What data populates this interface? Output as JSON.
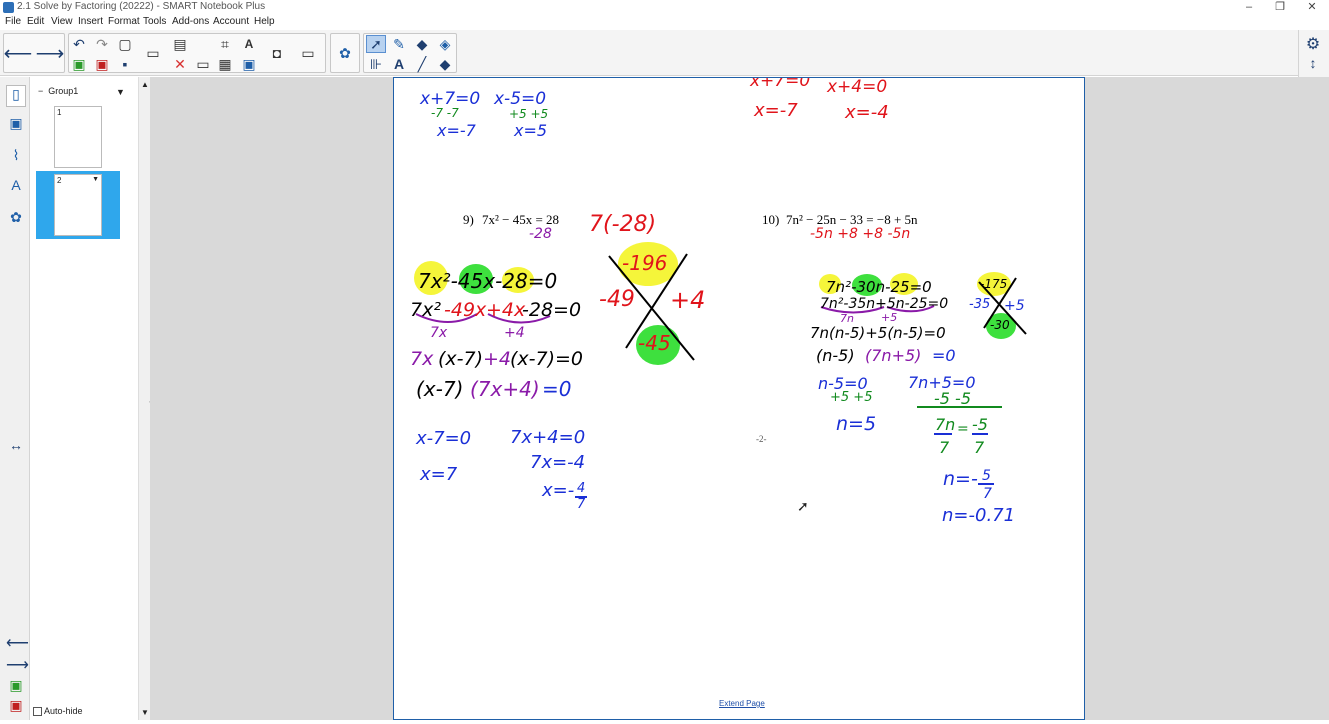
{
  "window": {
    "title": "2.1 Solve by Factoring (20222) - SMART Notebook Plus",
    "controls": [
      "–",
      "❐",
      "✕"
    ]
  },
  "menu": [
    "File",
    "Edit",
    "View",
    "Insert",
    "Format",
    "Tools",
    "Add-ons",
    "Account",
    "Help"
  ],
  "sorter": {
    "group_label": "Group1",
    "pages": [
      "1",
      "2"
    ]
  },
  "page_content": {
    "problem9_label": "9)",
    "problem9_eq": "7x² − 45x = 28",
    "problem10_label": "10)",
    "problem10_eq": "7n² − 25n − 33 = −8 + 5n",
    "page_number": "-2-",
    "extend_page": "Extend Page"
  },
  "handwriting": {
    "top_left_1": "x+7=0",
    "top_left_2": "-7  -7",
    "top_left_3": "x=-7",
    "top_mid_1": "x-5=0",
    "top_mid_2": "+5  +5",
    "top_mid_3": "x=5",
    "top_right_1": "x+7=0",
    "top_right_2": "x=-7",
    "top_right_3": "x+4=0",
    "top_right_4": "x=-4",
    "p9_sub": "-28",
    "p9_factor": "7(-28)",
    "p9_line1": "7x²-45x-28=0",
    "p9_line2a": "7x²",
    "p9_line2b": "-49x",
    "p9_line2c": "+4x",
    "p9_line2d": "-28=0",
    "p9_g1": "7x",
    "p9_g2": "+4",
    "p9_line3a": "7x",
    "p9_line3b": "(x-7)",
    "p9_line3c": "+4",
    "p9_line3d": "(x-7)=0",
    "p9_line4a": "(x-7)",
    "p9_line4b": "(7x+4)",
    "p9_line4c": "=0",
    "p9_x_top": "-196",
    "p9_x_left": "-49",
    "p9_x_right": "+4",
    "p9_x_bottom": "-45",
    "p9_sol1": "x-7=0",
    "p9_sol2": "x=7",
    "p9_sol3": "7x+4=0",
    "p9_sol4": "7x=-4",
    "p9_sol5": "x=-",
    "p9_frac_num": "4",
    "p9_frac_den": "7",
    "p10_sub": "-5n +8   +8 -5n",
    "p10_line1": "7n²-30n-25=0",
    "p10_line2": "7n²-35n+5n-25=0",
    "p10_g1": "7n",
    "p10_g2": "+5",
    "p10_line3": "7n(n-5)+5(n-5)=0",
    "p10_line4a": "(n-5)",
    "p10_line4b": "(7n+5)",
    "p10_line4c": "=0",
    "p10_x_top": "-175",
    "p10_x_left": "-35",
    "p10_x_right": "+5",
    "p10_x_bottom": "-30",
    "p10_sol1": "n-5=0",
    "p10_sol2": "+5 +5",
    "p10_sol3": "n=5",
    "p10_sol4": "7n+5=0",
    "p10_sol5": "-5  -5",
    "p10_frac1_num": "7n",
    "p10_frac1_mid": "=",
    "p10_frac1_rnum": "-5",
    "p10_frac_den": "7",
    "p10_sol6": "n=-",
    "p10_sol6_num": "5",
    "p10_sol6_den": "7",
    "p10_sol7": "n=-0.71"
  },
  "autohide_label": "Auto-hide",
  "colors": {
    "blue": "#1a2fd6",
    "red": "#e0141b",
    "green": "#118a1e",
    "purple": "#8a1aa8",
    "highlight_yellow": "#f5f53a",
    "highlight_green": "#3ee03e",
    "page_border": "#1f5fa8"
  }
}
